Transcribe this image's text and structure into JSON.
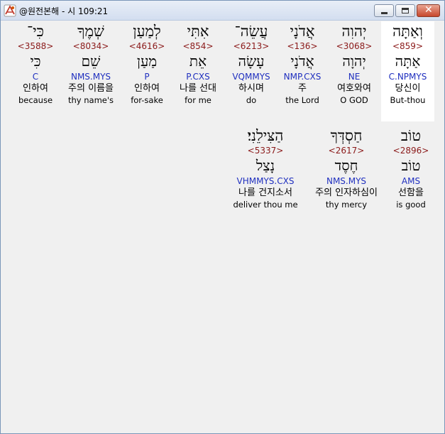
{
  "window": {
    "title": "@원전본해 - 시 109:21",
    "minimize_icon": "minimize-icon",
    "maximize_icon": "maximize-icon",
    "close_icon": "close-icon"
  },
  "rows": [
    {
      "words": [
        {
          "hebrew": "וְאַתָּה",
          "strong": "<859>",
          "lemma": "אַתָּה",
          "morph": "C.NPMYS",
          "korean": "당신이",
          "english": "But-thou",
          "selected": true
        },
        {
          "hebrew": "יְהוִה",
          "strong": "<3068>",
          "lemma": "יְהוָה",
          "morph": "NE",
          "korean": "여호와여",
          "english": "O GOD",
          "selected": false
        },
        {
          "hebrew": "אֲדֹנָי",
          "strong": "<136>",
          "lemma": "אֲדֹנָי",
          "morph": "NMP.CXS",
          "korean": "주",
          "english": "the Lord",
          "selected": false
        },
        {
          "hebrew": "עֲשֵׂה־",
          "strong": "<6213>",
          "lemma": "עָשָׂה",
          "morph": "VQMMYS",
          "korean": "하시며",
          "english": "do",
          "selected": false
        },
        {
          "hebrew": "אִתִּי",
          "strong": "<854>",
          "lemma": "אֵת",
          "morph": "P.CXS",
          "korean": "나를 선대",
          "english": "for me",
          "selected": false
        },
        {
          "hebrew": "לְמַעַן",
          "strong": "<4616>",
          "lemma": "מַעַן",
          "morph": "P",
          "korean": "인하여",
          "english": "for-sake",
          "selected": false
        },
        {
          "hebrew": "שְׁמֶךָ",
          "strong": "<8034>",
          "lemma": "שֵׁם",
          "morph": "NMS.MYS",
          "korean": "주의 이름을",
          "english": "thy name's",
          "selected": false
        },
        {
          "hebrew": "כִּי־",
          "strong": "<3588>",
          "lemma": "כִּי",
          "morph": "C",
          "korean": "인하여",
          "english": "because",
          "selected": false
        }
      ]
    },
    {
      "words": [
        {
          "hebrew": "טוֹב",
          "strong": "<2896>",
          "lemma": "טוֹב",
          "morph": "AMS",
          "korean": "선함을",
          "english": "is good",
          "selected": false
        },
        {
          "hebrew": "חַסְדְּךָ",
          "strong": "<2617>",
          "lemma": "חֶסֶד",
          "morph": "NMS.MYS",
          "korean": "주의 인자하심이",
          "english": "thy mercy",
          "selected": false
        },
        {
          "hebrew": "הַצִּילֵנִי׃",
          "strong": "<5337>",
          "lemma": "נָצַל",
          "morph": "VHMMYS.CXS",
          "korean": "나를 건지소서",
          "english": "deliver thou me",
          "selected": false
        }
      ]
    }
  ]
}
